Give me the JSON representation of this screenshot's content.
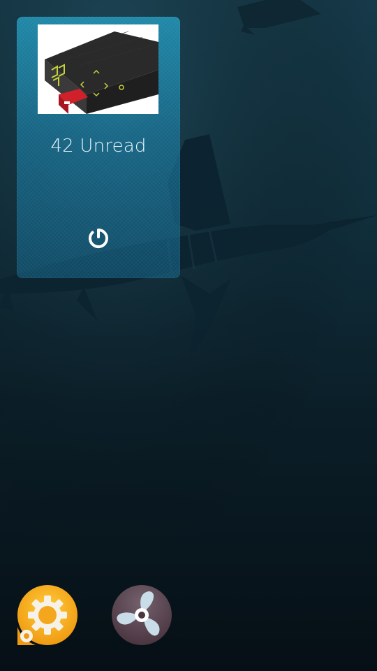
{
  "wallpaper": {
    "description_icon": "sailfish-wallpaper",
    "colors": {
      "top": "#163a4a",
      "bottom": "#060f15"
    }
  },
  "cover": {
    "title": "42 Unread",
    "thumbnail_icon": "router-box-image",
    "action_icon": "refresh-icon",
    "accent": "#2296b9"
  },
  "apps": [
    {
      "icon": "settings-gear-icon",
      "color": "#f2a81d"
    },
    {
      "icon": "fan-propeller-icon",
      "color": "#5a4450"
    }
  ]
}
